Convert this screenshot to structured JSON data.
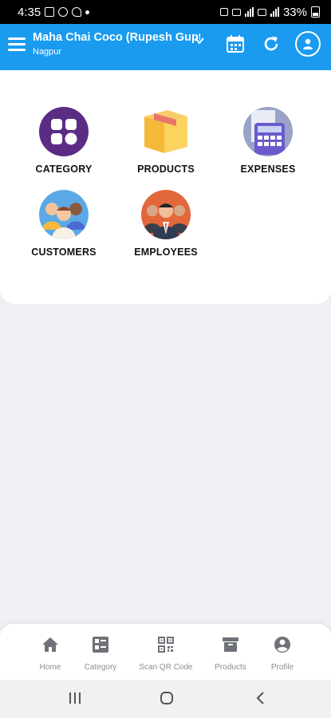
{
  "status": {
    "time": "4:35",
    "battery": "33%"
  },
  "header": {
    "store_name": "Maha Chai Coco (Rupesh Gupta)",
    "location": "Nagpur"
  },
  "tiles": [
    {
      "label": "CATEGORY",
      "icon": "category-icon"
    },
    {
      "label": "PRODUCTS",
      "icon": "box-icon"
    },
    {
      "label": "EXPENSES",
      "icon": "calculator-icon"
    },
    {
      "label": "CUSTOMERS",
      "icon": "customers-icon"
    },
    {
      "label": "EMPLOYEES",
      "icon": "employees-icon"
    }
  ],
  "bottom_nav": [
    {
      "label": "Home",
      "icon": "home-icon"
    },
    {
      "label": "Category",
      "icon": "category-list-icon"
    },
    {
      "label": "Scan QR Code",
      "icon": "qr-code-icon"
    },
    {
      "label": "Products",
      "icon": "archive-icon"
    },
    {
      "label": "Profile",
      "icon": "profile-icon"
    }
  ],
  "colors": {
    "app_bar": "#1a9bf0",
    "category_purple": "#5b2c83",
    "background": "#eef0f5"
  }
}
